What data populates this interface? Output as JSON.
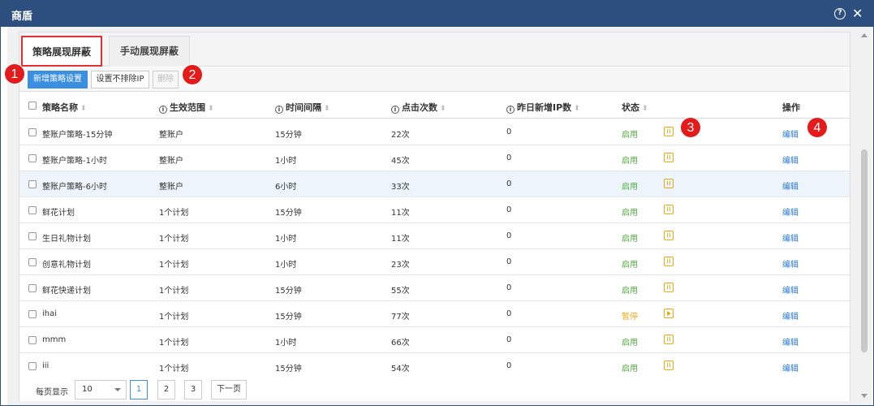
{
  "window": {
    "title": "商盾"
  },
  "tabs": [
    {
      "label": "策略展现屏蔽",
      "active": true
    },
    {
      "label": "手动展现屏蔽",
      "active": false
    }
  ],
  "toolbar": {
    "add_label": "新增策略设置",
    "exclude_ip_label": "设置不排除IP",
    "delete_label": "删除"
  },
  "markers": [
    "1",
    "2",
    "3",
    "4"
  ],
  "table": {
    "headers": {
      "name": "策略名称",
      "scope": "生效范围",
      "interval": "时间间隔",
      "clicks": "点击次数",
      "new_ip": "昨日新增IP数",
      "status": "状态",
      "action": "操作"
    },
    "rows": [
      {
        "name": "整账户策略-15分钟",
        "scope": "整账户",
        "interval": "15分钟",
        "clicks": "22次",
        "new_ip": "0",
        "status": "启用",
        "enabled": true,
        "action": "编辑"
      },
      {
        "name": "整账户策略-1小时",
        "scope": "整账户",
        "interval": "1小时",
        "clicks": "45次",
        "new_ip": "0",
        "status": "启用",
        "enabled": true,
        "action": "编辑"
      },
      {
        "name": "整账户策略-6小时",
        "scope": "整账户",
        "interval": "6小时",
        "clicks": "33次",
        "new_ip": "0",
        "status": "启用",
        "enabled": true,
        "action": "编辑"
      },
      {
        "name": "鲜花计划",
        "scope": "1个计划",
        "interval": "15分钟",
        "clicks": "11次",
        "new_ip": "0",
        "status": "启用",
        "enabled": true,
        "action": "编辑"
      },
      {
        "name": "生日礼物计划",
        "scope": "1个计划",
        "interval": "1小时",
        "clicks": "11次",
        "new_ip": "0",
        "status": "启用",
        "enabled": true,
        "action": "编辑"
      },
      {
        "name": "创意礼物计划",
        "scope": "1个计划",
        "interval": "1小时",
        "clicks": "23次",
        "new_ip": "0",
        "status": "启用",
        "enabled": true,
        "action": "编辑"
      },
      {
        "name": "鲜花快递计划",
        "scope": "1个计划",
        "interval": "15分钟",
        "clicks": "55次",
        "new_ip": "0",
        "status": "启用",
        "enabled": true,
        "action": "编辑"
      },
      {
        "name": "ihai",
        "scope": "1个计划",
        "interval": "15分钟",
        "clicks": "77次",
        "new_ip": "0",
        "status": "暂停",
        "enabled": false,
        "action": "编辑"
      },
      {
        "name": "mmm",
        "scope": "1个计划",
        "interval": "1小时",
        "clicks": "66次",
        "new_ip": "0",
        "status": "启用",
        "enabled": true,
        "action": "编辑"
      },
      {
        "name": "iii",
        "scope": "1个计划",
        "interval": "15分钟",
        "clicks": "54次",
        "new_ip": "0",
        "status": "启用",
        "enabled": true,
        "action": "编辑"
      }
    ]
  },
  "pager": {
    "per_page_label": "每页显示",
    "per_page_value": "10",
    "pages": [
      "1",
      "2",
      "3"
    ],
    "current": "1",
    "next_label": "下一页"
  },
  "colors": {
    "titlebar": "#2d4f7f",
    "primary": "#3b8fe0",
    "enabled": "#4caf3a",
    "paused": "#e6a817",
    "link": "#2a7ad8",
    "marker": "#e31b1b"
  }
}
